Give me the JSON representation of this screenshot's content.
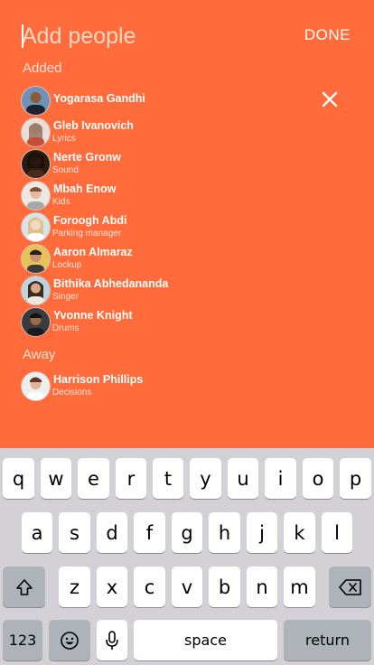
{
  "header": {
    "placeholder": "Add people",
    "done_label": "DONE"
  },
  "sections": {
    "added_label": "Added",
    "away_label": "Away"
  },
  "people_added": [
    {
      "name": "Yogarasa Gandhi",
      "role": ""
    },
    {
      "name": "Gleb Ivanovich",
      "role": "Lyrics"
    },
    {
      "name": "Nerte Gronw",
      "role": "Sound"
    },
    {
      "name": "Mbah Enow",
      "role": "Kids"
    },
    {
      "name": "Foroogh Abdi",
      "role": "Parking manager"
    },
    {
      "name": "Aaron Almaraz",
      "role": "Lockup"
    },
    {
      "name": "Bithika Abhedananda",
      "role": "Singer"
    },
    {
      "name": "Yvonne Knight",
      "role": "Drums"
    }
  ],
  "people_away": [
    {
      "name": "Harrison Phillips",
      "role": "Decisions"
    }
  ],
  "keyboard": {
    "row1": [
      "q",
      "w",
      "e",
      "r",
      "t",
      "y",
      "u",
      "i",
      "o",
      "p"
    ],
    "row2": [
      "a",
      "s",
      "d",
      "f",
      "g",
      "h",
      "j",
      "k",
      "l"
    ],
    "row3": [
      "z",
      "x",
      "c",
      "v",
      "b",
      "n",
      "m"
    ],
    "numbers_label": "123",
    "space_label": "space",
    "return_label": "return",
    "icons": [
      "shift-icon",
      "delete-icon",
      "emoji-icon",
      "microphone-icon",
      "close-icon"
    ]
  },
  "colors": {
    "background": "#ff6b3a",
    "keyboard_bg": "#d3d1d6",
    "key": "#ffffff",
    "key_special": "#aeb2b9"
  }
}
